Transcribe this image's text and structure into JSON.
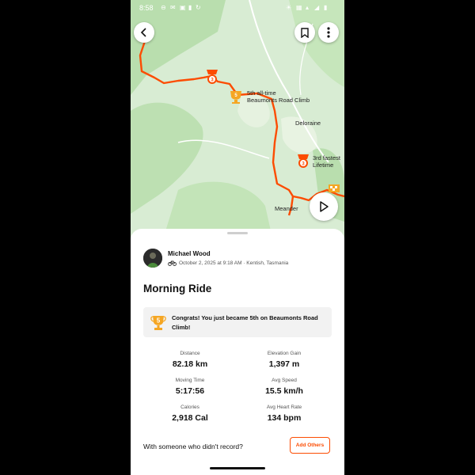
{
  "status_bar": {
    "time": "8:58"
  },
  "map": {
    "labels": {
      "segment_5th_line1": "5th all-time",
      "segment_5th_line2": "Beaumonts Road Climb",
      "town_deloraine": "Deloraine",
      "segment_3rd_line1": "3rd fastest",
      "segment_3rd_line2": "Lifetime",
      "town_meander": "Meander"
    },
    "badge_numbers": {
      "trophy_5": "5",
      "medal_3a": "3",
      "medal_3b": "3"
    }
  },
  "activity": {
    "athlete_name": "Michael Wood",
    "meta": "October 2, 2025 at 9:18 AM · Kentish, Tasmania",
    "title": "Morning Ride",
    "congrats": {
      "rank": "5",
      "message": "Congrats! You just became 5th on Beaumonts Road Climb!"
    },
    "stats": [
      {
        "label": "Distance",
        "value": "82.18 km"
      },
      {
        "label": "Elevation Gain",
        "value": "1,397 m"
      },
      {
        "label": "Moving Time",
        "value": "5:17:56"
      },
      {
        "label": "Avg Speed",
        "value": "15.5 km/h"
      },
      {
        "label": "Calories",
        "value": "2,918 Cal"
      },
      {
        "label": "Avg Heart Rate",
        "value": "134 bpm"
      }
    ],
    "record_prompt": "With someone who didn't record?",
    "add_others_label": "Add Others"
  },
  "colors": {
    "route": "#fc4c02",
    "accent": "#fc4c02",
    "trophy": "#f5a623",
    "map_green": "#bfe3b4"
  }
}
